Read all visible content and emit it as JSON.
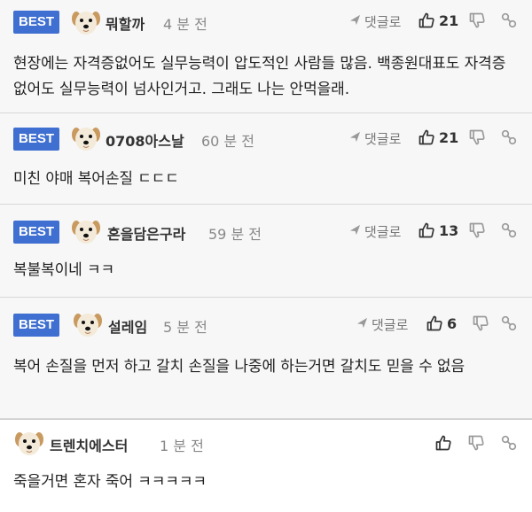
{
  "comments": [
    {
      "best": true,
      "badge": "BEST",
      "nickname": "뭐할까",
      "time": "4 분 전",
      "reply_label": "댓글로",
      "likes": "21",
      "text": "현장에는 자격증없어도 실무능력이 압도적인 사람들 많음. 백종원대표도 자격증없어도 실무능력이 넘사인거고. 그래도 나는 안먹을래."
    },
    {
      "best": true,
      "badge": "BEST",
      "nickname": "0708아스날",
      "time": "60 분 전",
      "reply_label": "댓글로",
      "likes": "21",
      "text": "미친 야매 복어손질 ㄷㄷㄷ"
    },
    {
      "best": true,
      "badge": "BEST",
      "nickname": "혼을담은구라",
      "time": "59 분 전",
      "reply_label": "댓글로",
      "likes": "13",
      "text": "복불복이네 ㅋㅋ"
    },
    {
      "best": true,
      "badge": "BEST",
      "nickname": "설레임",
      "time": "5 분 전",
      "reply_label": "댓글로",
      "likes": "6",
      "text": "복어 손질을 먼저 하고 갈치 손질을 나중에 하는거면 갈치도 믿을 수 없음"
    },
    {
      "best": false,
      "nickname": "트렌치에스터",
      "time": "1 분 전",
      "text": "죽을거면 혼자 죽어 ㅋㅋㅋㅋㅋ"
    }
  ],
  "icons": {
    "reply": "reply-arrow-icon",
    "like": "thumbs-up-icon",
    "dislike": "thumbs-down-icon",
    "share": "link-icon",
    "avatar": "dog-face-icon"
  }
}
